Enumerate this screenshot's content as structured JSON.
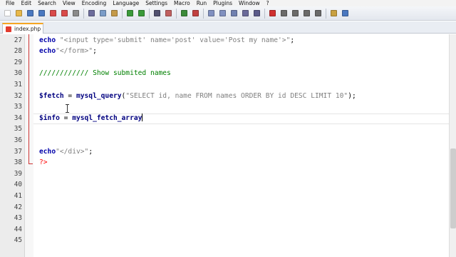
{
  "menu": [
    "File",
    "Edit",
    "Search",
    "View",
    "Encoding",
    "Language",
    "Settings",
    "Macro",
    "Run",
    "Plugins",
    "Window",
    "?"
  ],
  "toolbar": {
    "buttons": [
      {
        "name": "new-file-icon",
        "color": "#ffffff"
      },
      {
        "name": "open-file-icon",
        "color": "#e8b84a"
      },
      {
        "name": "save-icon",
        "color": "#4a78c0"
      },
      {
        "name": "save-all-icon",
        "color": "#4a78c0"
      },
      {
        "name": "close-icon",
        "color": "#d94a4a"
      },
      {
        "name": "close-all-icon",
        "color": "#d94a4a"
      },
      {
        "name": "print-icon",
        "color": "#8a8a8a"
      },
      {
        "sep": true
      },
      {
        "name": "cut-icon",
        "color": "#6c6c9c"
      },
      {
        "name": "copy-icon",
        "color": "#7a9cc8"
      },
      {
        "name": "paste-icon",
        "color": "#c49a4a"
      },
      {
        "sep": true
      },
      {
        "name": "undo-icon",
        "color": "#3a9a3a"
      },
      {
        "name": "redo-icon",
        "color": "#3a9a3a"
      },
      {
        "sep": true
      },
      {
        "name": "find-icon",
        "color": "#505070"
      },
      {
        "name": "replace-icon",
        "color": "#c06060"
      },
      {
        "sep": true
      },
      {
        "name": "zoom-in-icon",
        "color": "#3a8a3a"
      },
      {
        "name": "zoom-out-icon",
        "color": "#c04040"
      },
      {
        "sep": true
      },
      {
        "name": "sync-v-icon",
        "color": "#8090c0"
      },
      {
        "name": "sync-h-icon",
        "color": "#8090c0"
      },
      {
        "name": "word-wrap-icon",
        "color": "#7080b0"
      },
      {
        "name": "show-all-chars-icon",
        "color": "#6a6a9a"
      },
      {
        "name": "indent-guide-icon",
        "color": "#5a5a8a"
      },
      {
        "sep": true
      },
      {
        "name": "record-macro-icon",
        "color": "#d03030"
      },
      {
        "name": "stop-macro-icon",
        "color": "#6a6a6a"
      },
      {
        "name": "play-macro-icon",
        "color": "#6a6a6a"
      },
      {
        "name": "play-multiple-icon",
        "color": "#6a6a6a"
      },
      {
        "name": "save-macro-icon",
        "color": "#6a6a6a"
      },
      {
        "sep": true
      },
      {
        "name": "doc-map-icon",
        "color": "#c8a040"
      },
      {
        "name": "function-list-icon",
        "color": "#4a78c0"
      }
    ]
  },
  "tab": {
    "label": "index.php"
  },
  "editor": {
    "lines": [
      {
        "n": "27",
        "tokens": [
          {
            "t": "kw",
            "v": "echo"
          },
          {
            "t": "plain",
            "v": " "
          },
          {
            "t": "str",
            "v": "\"<input type='submit' name='post' value='Post my name'>\""
          },
          {
            "t": "plain",
            "v": ";"
          }
        ]
      },
      {
        "n": "28",
        "tokens": [
          {
            "t": "kw",
            "v": "echo"
          },
          {
            "t": "str",
            "v": "\"</form>\""
          },
          {
            "t": "plain",
            "v": ";"
          }
        ]
      },
      {
        "n": "29",
        "tokens": []
      },
      {
        "n": "30",
        "tokens": [
          {
            "t": "comment",
            "v": "//////////// Show submited names"
          }
        ]
      },
      {
        "n": "31",
        "tokens": []
      },
      {
        "n": "32",
        "tokens": [
          {
            "t": "var",
            "v": "$fetch"
          },
          {
            "t": "plain",
            "v": " = "
          },
          {
            "t": "fn",
            "v": "mysql_query"
          },
          {
            "t": "plain",
            "v": "("
          },
          {
            "t": "str",
            "v": "\"SELECT id, name FROM names ORDER BY id DESC LIMIT 10\""
          },
          {
            "t": "plain",
            "v": ");"
          }
        ]
      },
      {
        "n": "33",
        "tokens": []
      },
      {
        "n": "34",
        "tokens": [
          {
            "t": "var",
            "v": "$info"
          },
          {
            "t": "plain",
            "v": " = "
          },
          {
            "t": "fn",
            "v": "mysql_fetch_array"
          }
        ],
        "caret": true
      },
      {
        "n": "35",
        "tokens": []
      },
      {
        "n": "36",
        "tokens": []
      },
      {
        "n": "37",
        "tokens": [
          {
            "t": "kw",
            "v": "echo"
          },
          {
            "t": "str",
            "v": "\"</div>\""
          },
          {
            "t": "plain",
            "v": ";"
          }
        ]
      },
      {
        "n": "38",
        "tokens": [
          {
            "t": "php-tag",
            "v": "?>"
          }
        ]
      },
      {
        "n": "39",
        "tokens": []
      },
      {
        "n": "40",
        "tokens": []
      },
      {
        "n": "41",
        "tokens": []
      },
      {
        "n": "42",
        "tokens": []
      },
      {
        "n": "43",
        "tokens": []
      },
      {
        "n": "44",
        "tokens": []
      },
      {
        "n": "45",
        "tokens": []
      }
    ]
  }
}
